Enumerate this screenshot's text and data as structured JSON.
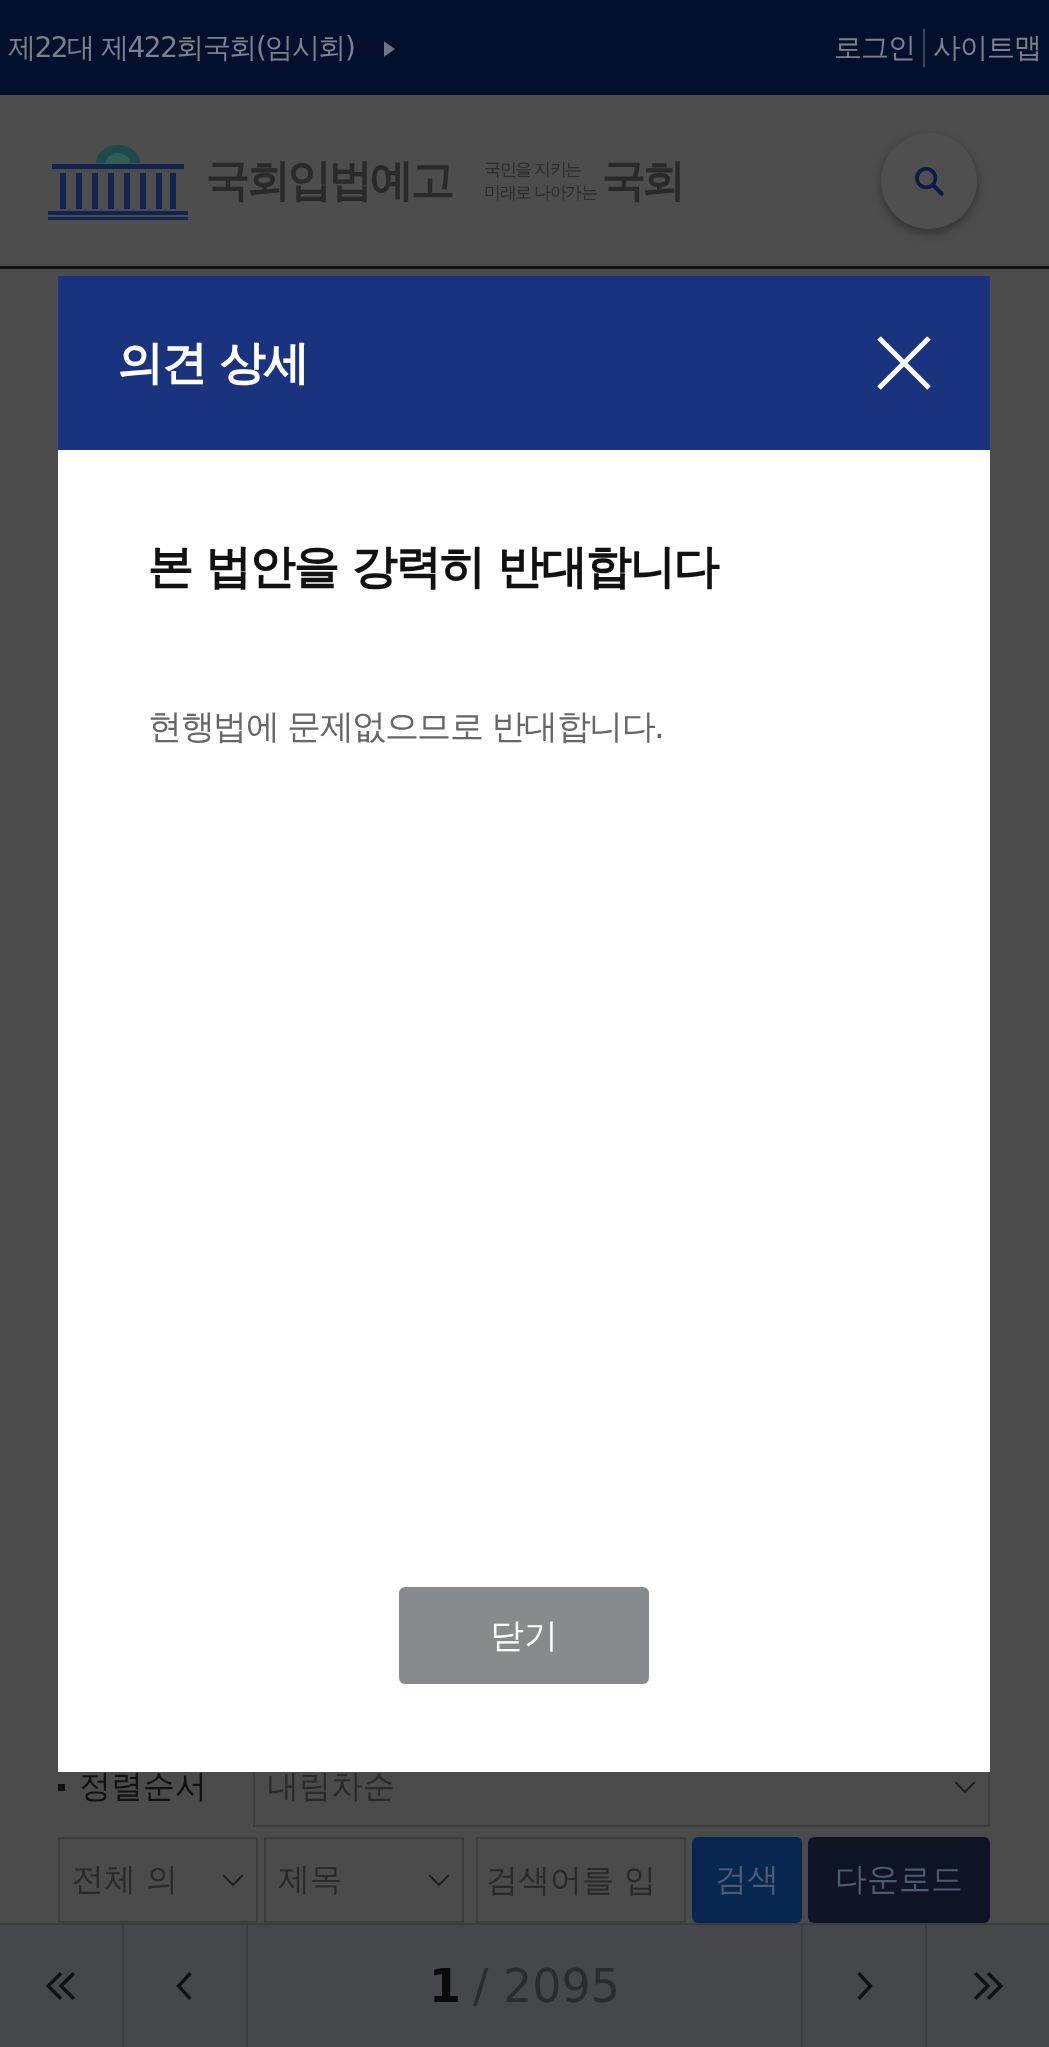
{
  "top_bar": {
    "session": "제22대 제422회국회(임시회)",
    "links": [
      "로그인",
      "사이트맵"
    ]
  },
  "header": {
    "site_name": "국회입법예고",
    "slogan_lines": [
      "국민을 지키는",
      "미래로 나아가는"
    ],
    "slogan_mark": "국회"
  },
  "modal": {
    "title": "의견 상세",
    "heading": "본 법안을 강력히 반대합니다",
    "body": "현행법에 문제없으므로 반대합니다.",
    "close_button": "닫기"
  },
  "sort": {
    "label": "정렬순서",
    "value": "내림차순"
  },
  "filters": {
    "scope": "전체 의",
    "field": "제목",
    "search": {
      "placeholder": "검색어를 입"
    },
    "buttons": [
      {
        "label": "검색",
        "kind": "primary"
      },
      {
        "label": "다운로드",
        "kind": "dark"
      }
    ]
  },
  "pagination": {
    "current": "1",
    "total": "/ 2095"
  }
}
